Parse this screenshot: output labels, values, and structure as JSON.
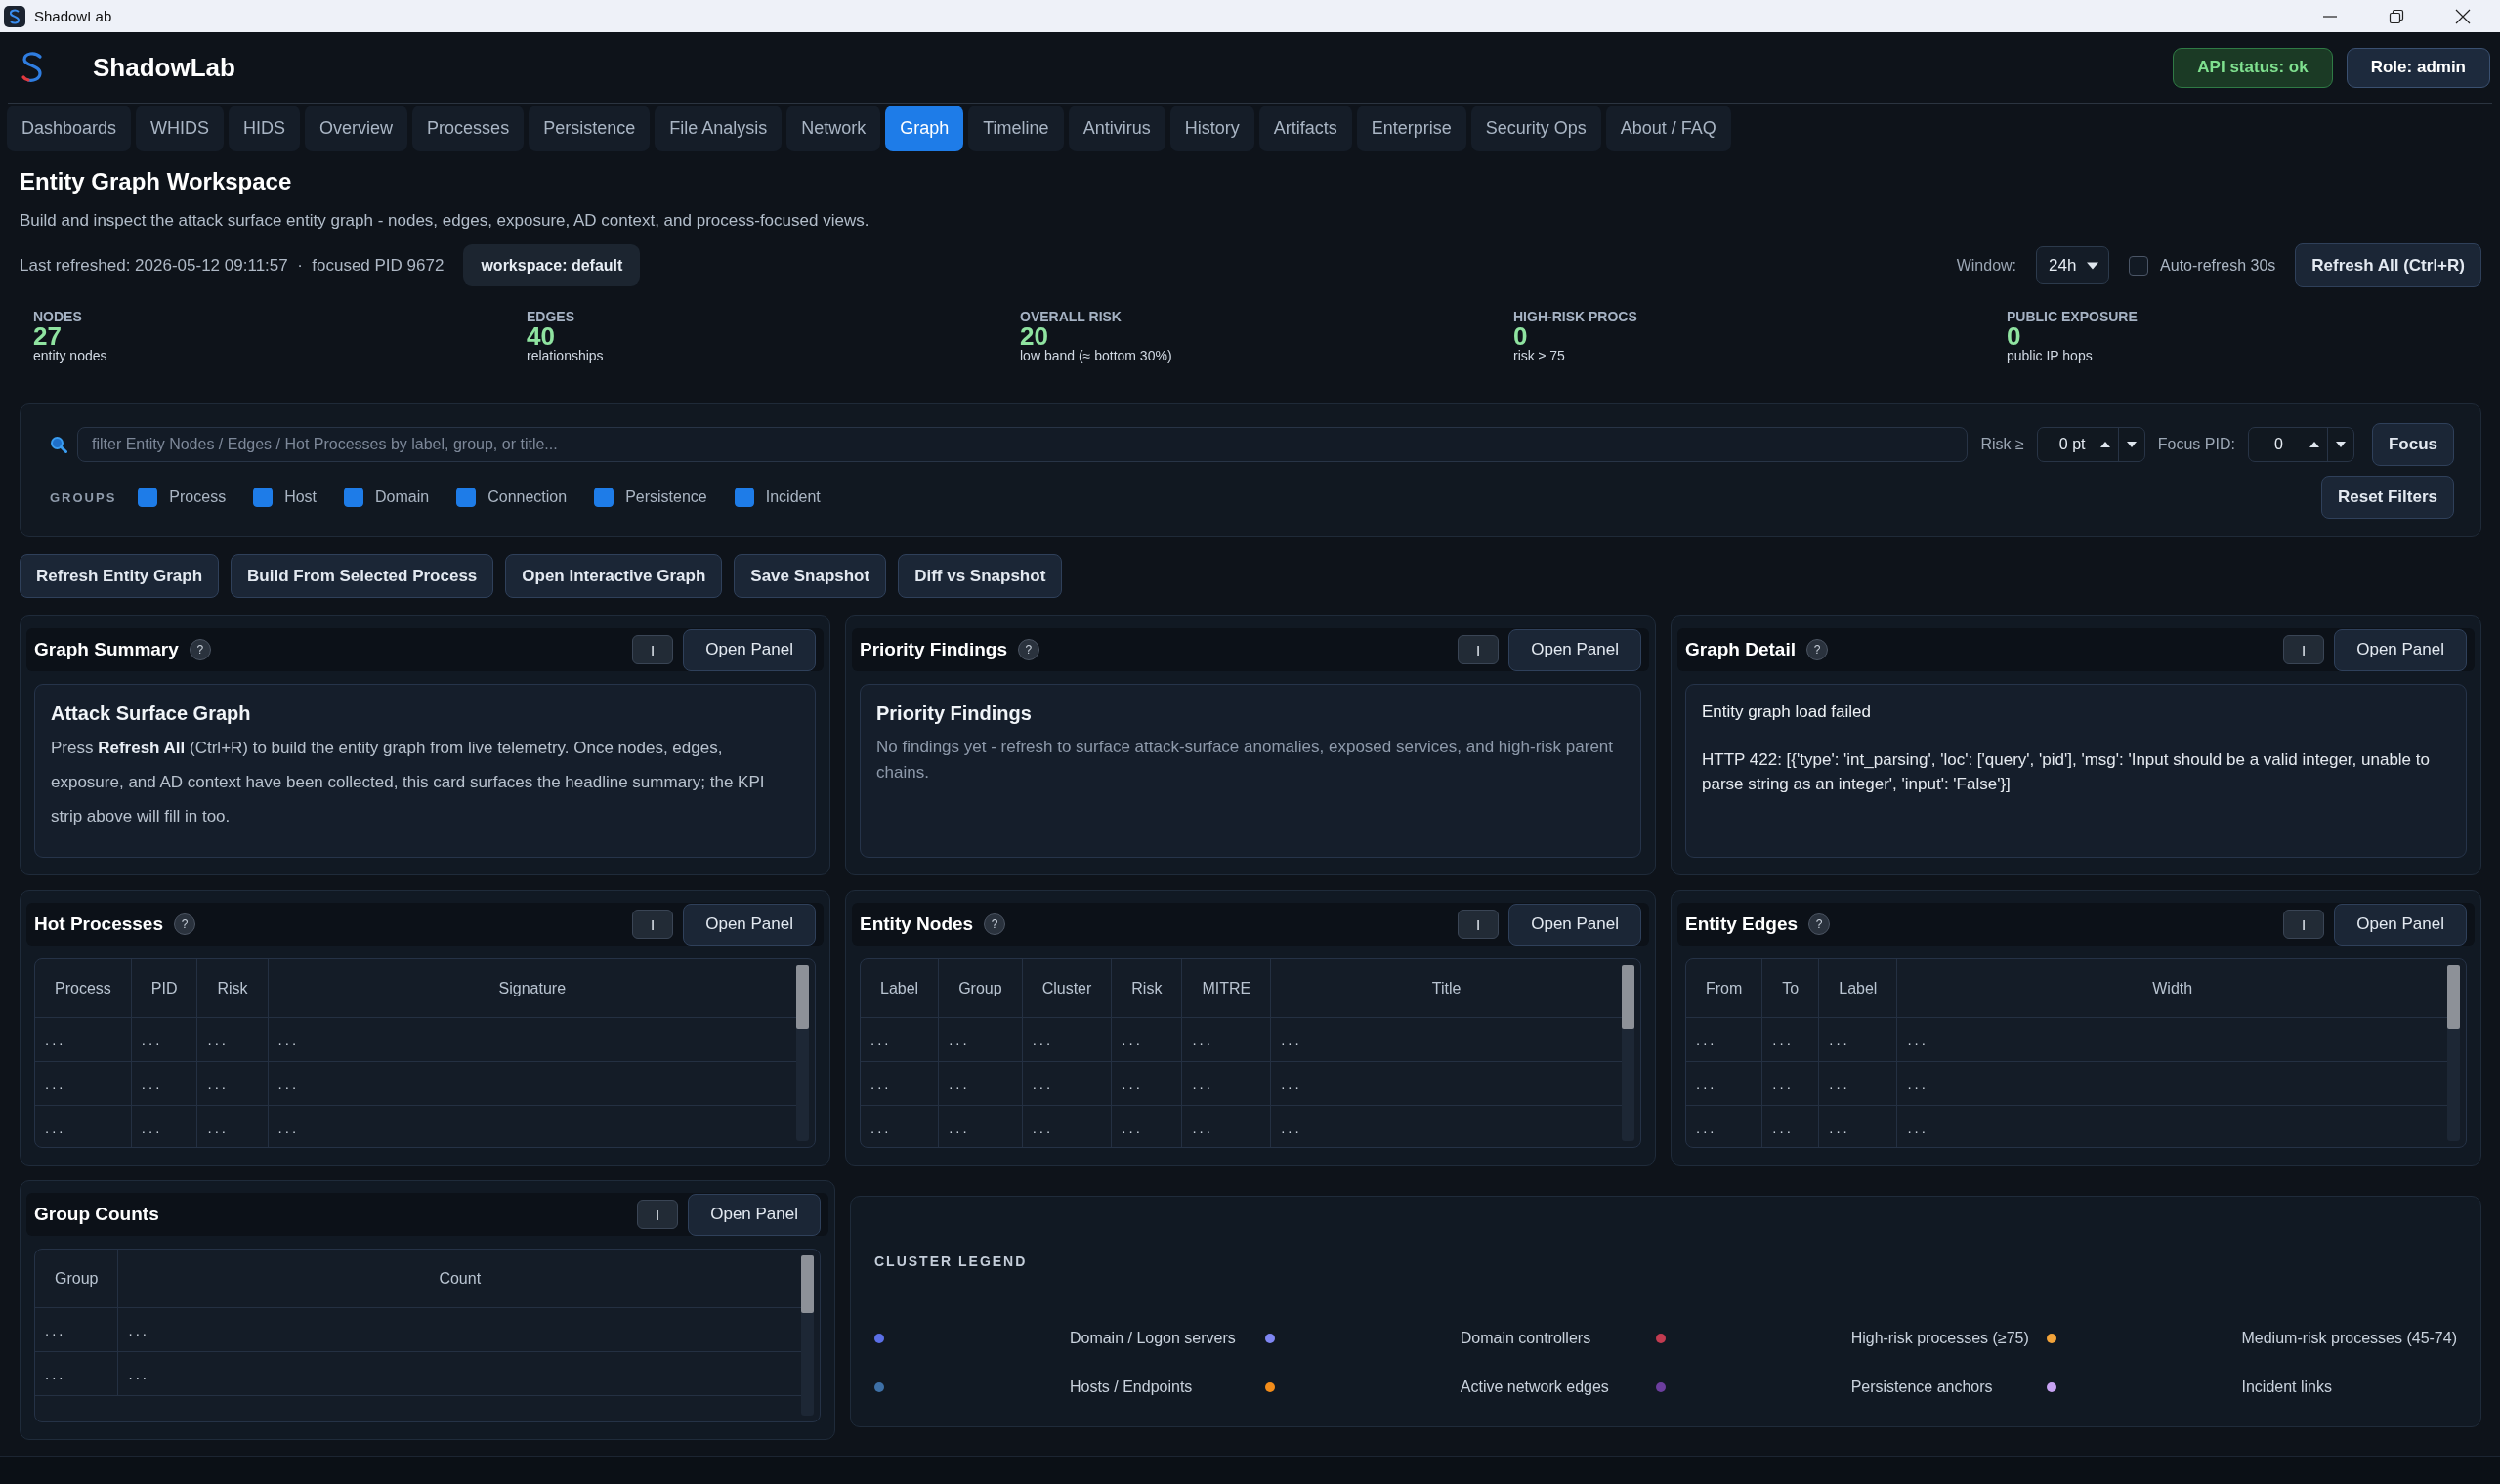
{
  "window": {
    "title": "ShadowLab"
  },
  "header": {
    "app_name": "ShadowLab",
    "api_status": "API status: ok",
    "role": "Role: admin"
  },
  "tabs": [
    {
      "label": "Dashboards",
      "selected": false
    },
    {
      "label": "WHIDS",
      "selected": false
    },
    {
      "label": "HIDS",
      "selected": false
    },
    {
      "label": "Overview",
      "selected": false
    },
    {
      "label": "Processes",
      "selected": false
    },
    {
      "label": "Persistence",
      "selected": false
    },
    {
      "label": "File Analysis",
      "selected": false
    },
    {
      "label": "Network",
      "selected": false
    },
    {
      "label": "Graph",
      "selected": true
    },
    {
      "label": "Timeline",
      "selected": false
    },
    {
      "label": "Antivirus",
      "selected": false
    },
    {
      "label": "History",
      "selected": false
    },
    {
      "label": "Artifacts",
      "selected": false
    },
    {
      "label": "Enterprise",
      "selected": false
    },
    {
      "label": "Security Ops",
      "selected": false
    },
    {
      "label": "About / FAQ",
      "selected": false
    }
  ],
  "page": {
    "title": "Entity Graph Workspace",
    "subtitle": "Build and inspect the attack surface entity graph - nodes, edges, exposure, AD context, and process-focused views.",
    "refresh_info": "Last refreshed: 2026-05-12 09:11:57  ·  focused PID 9672",
    "workspace": "workspace: default"
  },
  "controls": {
    "window_label": "Window:",
    "window_value": "24h",
    "auto_refresh": {
      "label": "Auto-refresh 30s",
      "checked": false
    },
    "refresh_button": "Refresh All (Ctrl+R)"
  },
  "kpis": [
    {
      "label": "NODES",
      "value": "27",
      "note": "entity nodes"
    },
    {
      "label": "EDGES",
      "value": "40",
      "note": "relationships"
    },
    {
      "label": "OVERALL RISK",
      "value": "20",
      "note": "low band (≈ bottom 30%)"
    },
    {
      "label": "HIGH-RISK PROCS",
      "value": "0",
      "note": "risk ≥ 75"
    },
    {
      "label": "PUBLIC EXPOSURE",
      "value": "0",
      "note": "public IP hops"
    }
  ],
  "filters": {
    "search": {
      "placeholder": "filter Entity Nodes / Edges / Hot Processes by label, group, or title..."
    },
    "risk_label": "Risk ≥",
    "risk_value": "0 pt",
    "focus_label": "Focus PID:",
    "focus_value": "0",
    "focus_button": "Focus",
    "groups_label": "GROUPS",
    "groups": [
      {
        "label": "Process",
        "checked": true
      },
      {
        "label": "Host",
        "checked": true
      },
      {
        "label": "Domain",
        "checked": true
      },
      {
        "label": "Connection",
        "checked": true
      },
      {
        "label": "Persistence",
        "checked": true
      },
      {
        "label": "Incident",
        "checked": true
      }
    ],
    "reset_button": "Reset Filters"
  },
  "actions": [
    "Refresh Entity Graph",
    "Build From Selected Process",
    "Open Interactive Graph",
    "Save Snapshot",
    "Diff vs Snapshot"
  ],
  "panels": [
    {
      "kind": "summary",
      "title": "Graph Summary",
      "help": "?",
      "toggle": "I",
      "open_button": "Open Panel",
      "card": {
        "heading": "Attack Surface Graph",
        "body": "Press **Refresh All** (Ctrl+R) to build the entity graph from live telemetry. Once nodes, edges, exposure, and AD context have been collected, this card surfaces the headline summary; the KPI strip above will fill in too."
      }
    },
    {
      "kind": "note",
      "title": "Priority Findings",
      "help": "?",
      "toggle": "I",
      "open_button": "Open Panel",
      "card": {
        "heading": "Priority Findings",
        "body": "No findings yet - refresh to surface attack-surface anomalies, exposed services, and high-risk parent chains."
      }
    },
    {
      "kind": "error",
      "title": "Graph Detail",
      "help": "?",
      "toggle": "I",
      "open_button": "Open Panel",
      "card": {
        "heading": "Entity graph load failed",
        "body": "HTTP 422: [{'type': 'int_parsing', 'loc': ['query', 'pid'], 'msg': 'Input should be a valid integer, unable to parse string as an integer', 'input': 'False'}]"
      }
    },
    {
      "kind": "table",
      "title": "Hot Processes",
      "help": "?",
      "toggle": "I",
      "open_button": "Open Panel",
      "columns": [
        "Process",
        "PID",
        "Risk",
        "Signature"
      ],
      "rows": [
        [
          "...",
          "...",
          "...",
          "..."
        ],
        [
          "...",
          "...",
          "...",
          "..."
        ],
        [
          "...",
          "...",
          "...",
          "..."
        ]
      ]
    },
    {
      "kind": "table",
      "title": "Entity Nodes",
      "help": "?",
      "toggle": "I",
      "open_button": "Open Panel",
      "columns": [
        "Label",
        "Group",
        "Cluster",
        "Risk",
        "MITRE",
        "Title"
      ],
      "rows": [
        [
          "...",
          "...",
          "...",
          "...",
          "...",
          "..."
        ],
        [
          "...",
          "...",
          "...",
          "...",
          "...",
          "..."
        ],
        [
          "...",
          "...",
          "...",
          "...",
          "...",
          "..."
        ]
      ]
    },
    {
      "kind": "table",
      "title": "Entity Edges",
      "help": "?",
      "toggle": "I",
      "open_button": "Open Panel",
      "columns": [
        "From",
        "To",
        "Label",
        "Width"
      ],
      "rows": [
        [
          "...",
          "...",
          "...",
          "..."
        ],
        [
          "...",
          "...",
          "...",
          "..."
        ],
        [
          "...",
          "...",
          "...",
          "..."
        ]
      ]
    },
    {
      "kind": "table",
      "title": "Group Counts",
      "toggle": "I",
      "open_button": "Open Panel",
      "columns": [
        "Group",
        "Count"
      ],
      "rows": [
        [
          "...",
          "..."
        ],
        [
          "...",
          "..."
        ]
      ]
    }
  ],
  "legend": {
    "title": "CLUSTER LEGEND",
    "items": [
      {
        "label": "Domain / Logon servers",
        "color": "#5b6fe6"
      },
      {
        "label": "Domain controllers",
        "color": "#7f86f2"
      },
      {
        "label": "High-risk processes (≥75)",
        "color": "#c23b50"
      },
      {
        "label": "Medium-risk processes (45-74)",
        "color": "#f2a33a"
      },
      {
        "label": "Hosts / Endpoints",
        "color": "#3e70a6"
      },
      {
        "label": "Active network edges",
        "color": "#f28c1a"
      },
      {
        "label": "Persistence anchors",
        "color": "#6c3e9e"
      },
      {
        "label": "Incident links",
        "color": "#c7a2f2"
      }
    ]
  }
}
